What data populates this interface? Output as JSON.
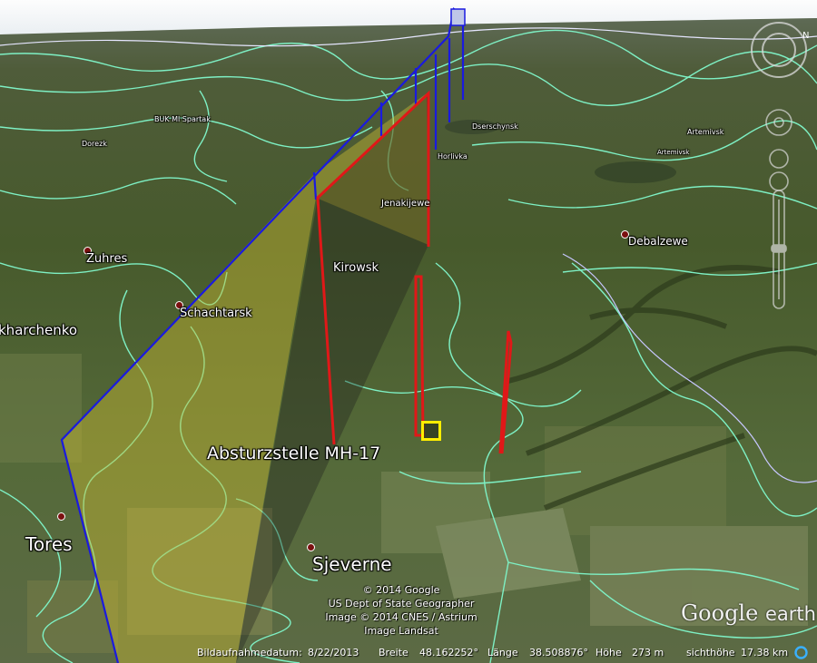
{
  "map": {
    "places": [
      {
        "id": "zuhres",
        "name": "Zuhres",
        "size": "md"
      },
      {
        "id": "schachtarsk",
        "name": "Schachtarsk",
        "size": "md"
      },
      {
        "id": "kharchenko",
        "name": "kharchenko",
        "size": "md"
      },
      {
        "id": "tores",
        "name": "Tores",
        "size": "lg"
      },
      {
        "id": "sjeverne",
        "name": "Sjeverne",
        "size": "lg"
      },
      {
        "id": "kirowsk",
        "name": "Kirowsk",
        "size": "md"
      },
      {
        "id": "jenakijewe",
        "name": "Jenakijewe",
        "size": "sm"
      },
      {
        "id": "horlivka",
        "name": "Horlivka",
        "size": "sm"
      },
      {
        "id": "debalzewe",
        "name": "Debalzewe",
        "size": "md"
      },
      {
        "id": "dorezk",
        "name": "Dorezk",
        "size": "sm"
      },
      {
        "id": "buk-ml",
        "name": "BUK Ml Spartak",
        "size": "sm"
      },
      {
        "id": "dserschynsk",
        "name": "Dserschynsk",
        "size": "sm"
      },
      {
        "id": "artemivsk",
        "name": "Artemivsk",
        "size": "sm"
      },
      {
        "id": "artemivsk-2",
        "name": "Artemivsk",
        "size": "sm"
      }
    ],
    "crash_site_label": "Absturzstelle MH-17",
    "copyright": {
      "line1": "© 2014 Google",
      "line2": "US Dept of State Geographer",
      "line3": "Image © 2014 CNES / Astrium",
      "line4": "Image Landsat"
    },
    "logo": {
      "word1": "Google",
      "word2": "earth"
    },
    "colors": {
      "flight_path": "#1a1adf",
      "missile_track": "#e01818",
      "shadow_fill": "#c8b832",
      "border_lines": "#7ef0c4",
      "marker": "#ffee00"
    }
  },
  "statusbar": {
    "imagery_date_label": "Bildaufnahmedatum:",
    "imagery_date": "8/22/2013",
    "lat_label": "Breite",
    "lat_value": "48.162252°",
    "lon_label": "Länge",
    "lon_value": "38.508876°",
    "elev_label": "Höhe",
    "elev_value": "273 m",
    "eye_label": "sichthöhe",
    "eye_value": "17.38 km"
  },
  "nav": {
    "compass_letter": "N"
  }
}
